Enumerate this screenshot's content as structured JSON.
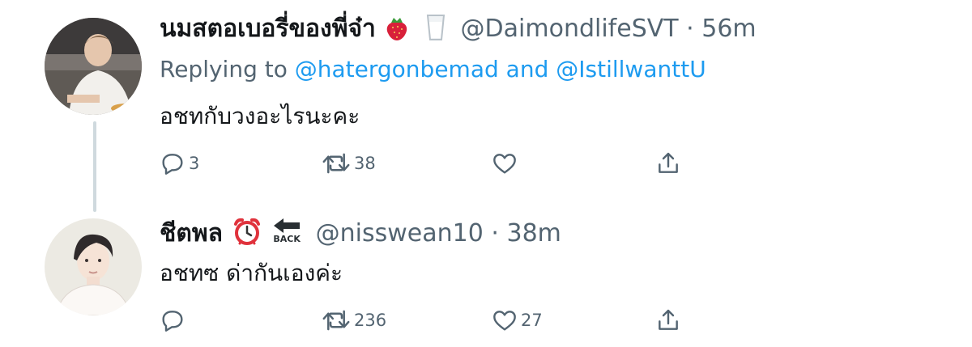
{
  "tweets": [
    {
      "display_name": "นมสตอเบอรี่ของพี่จ๋า",
      "name_icons": [
        "strawberry-emoji",
        "milk-glass-emoji"
      ],
      "handle": "@DaimondlifeSVT",
      "separator": "·",
      "time": "56m",
      "replying_prefix": "Replying to",
      "replying_mention_1": "@hatergonbemad",
      "replying_joiner": "and",
      "replying_mention_2": "@IstillwanttU",
      "text": "อชทกับวงอะไรนะคะ",
      "reply_count": "3",
      "retweet_count": "38",
      "like_count": ""
    },
    {
      "display_name": "ชีตพล",
      "name_icons": [
        "alarm-clock-emoji",
        "back-arrow-emoji"
      ],
      "back_emoji_text": "BACK",
      "handle": "@nisswean10",
      "separator": "·",
      "time": "38m",
      "text": "อชทซ ด่ากันเองค่ะ",
      "reply_count": "",
      "retweet_count": "236",
      "like_count": "27"
    }
  ],
  "colors": {
    "text": "#14171a",
    "secondary": "#536471",
    "link": "#1d9bf0",
    "thread_line": "#cfd9de"
  }
}
